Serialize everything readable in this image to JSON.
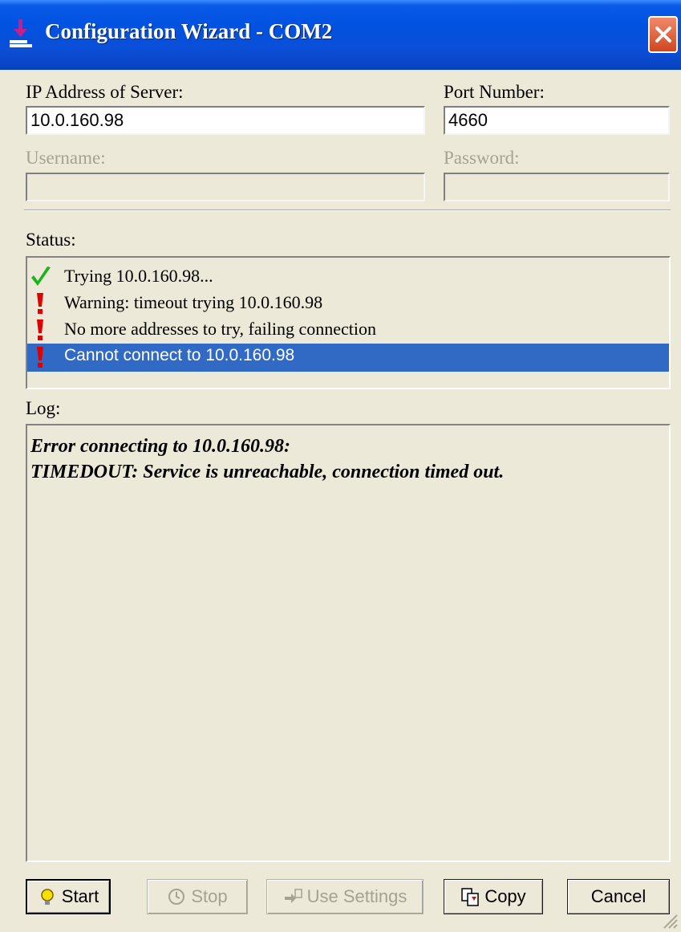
{
  "window": {
    "title": "Configuration Wizard - COM2"
  },
  "server": {
    "ip_label": "IP Address of Server:",
    "ip_value": "10.0.160.98",
    "port_label": "Port Number:",
    "port_value": "4660",
    "username_label": "Username:",
    "username_value": "",
    "password_label": "Password:",
    "password_value": ""
  },
  "status": {
    "label": "Status:",
    "items": [
      {
        "icon": "checkmark-icon",
        "text": "Trying 10.0.160.98...",
        "selected": false
      },
      {
        "icon": "exclamation-icon",
        "text": "Warning: timeout trying 10.0.160.98",
        "selected": false
      },
      {
        "icon": "exclamation-icon",
        "text": "No more addresses to try, failing connection",
        "selected": false
      },
      {
        "icon": "exclamation-icon",
        "text": "Cannot connect to 10.0.160.98",
        "selected": true
      }
    ]
  },
  "log": {
    "label": "Log:",
    "lines": [
      "Error connecting to 10.0.160.98:",
      "TIMEDOUT: Service is unreachable, connection timed out."
    ]
  },
  "buttons": {
    "start": "Start",
    "stop": "Stop",
    "use_settings": "Use Settings",
    "copy": "Copy",
    "cancel": "Cancel"
  },
  "colors": {
    "titlebar": "#0052E0",
    "dialog_bg": "#ECE9D8",
    "selection": "#316AC5",
    "disabled_text": "#A7A28F",
    "check_green": "#1DB31D",
    "exclaim_red": "#E00000"
  }
}
